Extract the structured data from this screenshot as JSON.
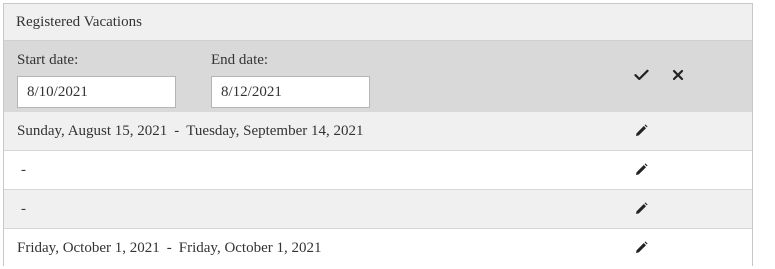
{
  "panel": {
    "title": "Registered Vacations"
  },
  "edit_form": {
    "start_label": "Start date:",
    "start_value": "8/10/2021",
    "end_label": "End date:",
    "end_value": "8/12/2021",
    "confirm_icon": "check-icon",
    "cancel_icon": "close-icon"
  },
  "vacations": [
    {
      "start": "Sunday, August 15, 2021",
      "separator": "-",
      "end": "Tuesday, September 14, 2021",
      "edit_icon": "pencil-icon"
    },
    {
      "start": "",
      "separator": "-",
      "end": "",
      "edit_icon": "pencil-icon"
    },
    {
      "start": "",
      "separator": "-",
      "end": "",
      "edit_icon": "pencil-icon"
    },
    {
      "start": "Friday, October 1, 2021",
      "separator": "-",
      "end": "Friday, October 1, 2021",
      "edit_icon": "pencil-icon"
    }
  ]
}
